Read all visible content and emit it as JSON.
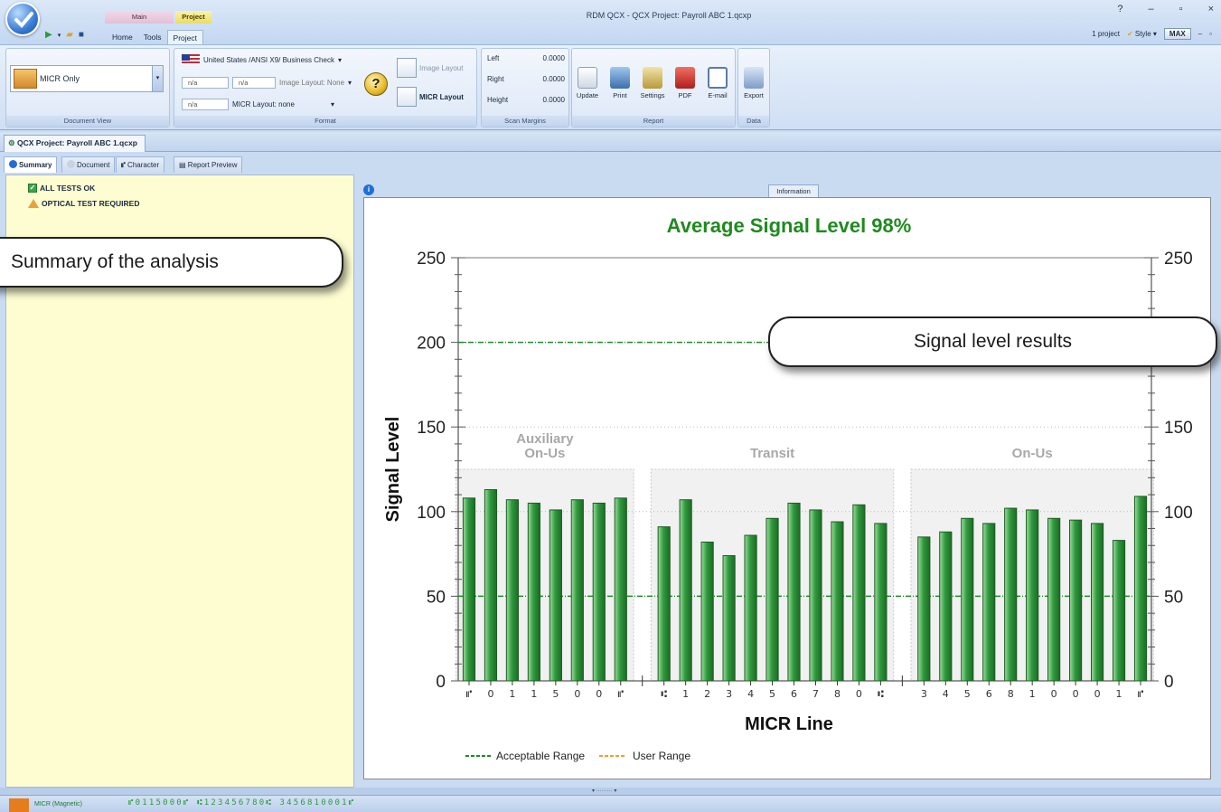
{
  "app": {
    "window_title": "RDM QCX - QCX Project: Payroll ABC 1.qcxp",
    "context_tabs": {
      "main": "Main",
      "project": "Project"
    },
    "menu_tabs": [
      "Home",
      "Tools",
      "Project"
    ],
    "window_controls": {
      "help": "?",
      "minimize": "–",
      "restore": "▫",
      "close": "×"
    },
    "right_tools": {
      "projects": "1 project",
      "style": "Style",
      "max": "MAX"
    }
  },
  "ribbon": {
    "document_view": {
      "selected": "MICR Only",
      "label": "Document View"
    },
    "format": {
      "country": "United States /ANSI X9/ Business Check",
      "na1": "n/a",
      "na2": "n/a",
      "na3": "n/a",
      "image_layout": "Image Layout: None",
      "micr_layout": "MICR Layout: none",
      "label": "Format",
      "image_layout_btn": "Image Layout",
      "micr_layout_btn": "MICR Layout"
    },
    "scan_margins": {
      "rows": [
        {
          "k": "Left",
          "v": "0.0000"
        },
        {
          "k": "Right",
          "v": "0.0000"
        },
        {
          "k": "Height",
          "v": "0.0000"
        }
      ],
      "label": "Scan Margins"
    },
    "report": {
      "buttons": [
        "Update",
        "Print",
        "Settings",
        "PDF",
        "E-mail"
      ],
      "label": "Report"
    },
    "data": {
      "buttons": [
        "Export"
      ],
      "label": "Data"
    }
  },
  "doc_tab": "QCX Project: Payroll ABC 1.qcxp",
  "subtabs": [
    "Summary",
    "Document",
    "Character",
    "Report Preview"
  ],
  "summary": {
    "line1": "ALL TESTS OK",
    "line2": "OPTICAL TEST REQUIRED"
  },
  "info_tab": "Information",
  "callouts": {
    "left": "Summary of the analysis",
    "right": "Signal level results"
  },
  "status": {
    "label": "MICR (Magnetic)",
    "micr": "⑈0115000⑈ ⑆123456780⑆ 3456810001⑈"
  },
  "colors": {
    "bar": "#2f9a3d",
    "acceptable": "#1d8a2b",
    "user": "#f0a030",
    "title": "#1f8a1f"
  },
  "chart_data": {
    "type": "bar",
    "title": "Average Signal Level 98%",
    "xlabel": "MICR Line",
    "ylabel": "Signal Level",
    "ylim": [
      0,
      250
    ],
    "yticks": [
      0,
      50,
      100,
      150,
      200,
      250
    ],
    "groups": [
      {
        "name": "Auxiliary On-Us",
        "lines": [
          "Auxiliary",
          "On-Us"
        ],
        "start": 0,
        "end": 7
      },
      {
        "name": "Transit",
        "lines": [
          "Transit"
        ],
        "start": 8,
        "end": 18
      },
      {
        "name": "On-Us",
        "lines": [
          "On-Us"
        ],
        "start": 19,
        "end": 29
      }
    ],
    "categories": [
      "⑈",
      "0",
      "1",
      "1",
      "5",
      "0",
      "0",
      "⑈",
      "⑆",
      "1",
      "2",
      "3",
      "4",
      "5",
      "6",
      "7",
      "8",
      "0",
      "⑆",
      "3",
      "4",
      "5",
      "6",
      "8",
      "1",
      "0",
      "0",
      "0",
      "1",
      "⑈"
    ],
    "values": [
      108,
      113,
      107,
      105,
      101,
      107,
      105,
      108,
      91,
      107,
      82,
      74,
      86,
      96,
      105,
      101,
      94,
      104,
      93,
      85,
      88,
      96,
      93,
      102,
      101,
      96,
      95,
      93,
      83,
      109
    ],
    "acceptable_range": [
      50,
      200
    ],
    "legend": [
      "Acceptable Range",
      "User Range"
    ],
    "legend_position": "bottom-left",
    "grid": false
  }
}
